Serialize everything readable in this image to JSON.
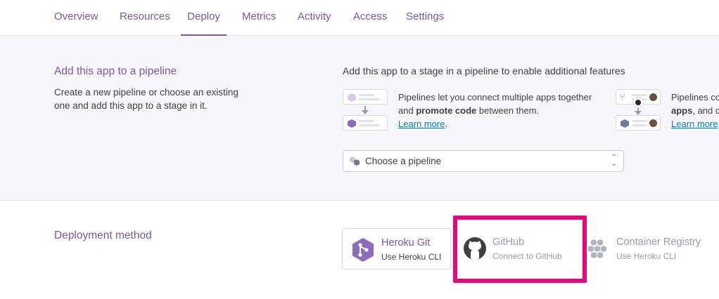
{
  "tabs": [
    {
      "label": "Overview"
    },
    {
      "label": "Resources"
    },
    {
      "label": "Deploy"
    },
    {
      "label": "Metrics"
    },
    {
      "label": "Activity"
    },
    {
      "label": "Access"
    },
    {
      "label": "Settings"
    }
  ],
  "active_tab": "Deploy",
  "pipeline": {
    "title": "Add this app to a pipeline",
    "description": "Create a new pipeline or choose an existing one and add this app to a stage in it.",
    "heading": "Add this app to a stage in a pipeline to enable additional features",
    "feature1": {
      "text_before": "Pipelines let you connect multiple apps together and ",
      "bold": "promote code",
      "text_after": " between them.",
      "link": "Learn more",
      "link_suffix": "."
    },
    "feature2": {
      "line1": "Pipelines co",
      "line2_bold": "apps",
      "line2_rest": ", and c",
      "link": "Learn more"
    },
    "select_placeholder": "Choose a pipeline"
  },
  "deployment": {
    "title": "Deployment method",
    "methods": [
      {
        "name": "Heroku Git",
        "sub": "Use Heroku CLI",
        "icon": "heroku-git-icon"
      },
      {
        "name": "GitHub",
        "sub": "Connect to GitHub",
        "icon": "github-icon"
      },
      {
        "name": "Container Registry",
        "sub": "Use Heroku CLI",
        "icon": "container-registry-icon"
      }
    ]
  },
  "colors": {
    "accent": "#79589f",
    "link": "#1474a7",
    "highlight": "#e5077c"
  }
}
